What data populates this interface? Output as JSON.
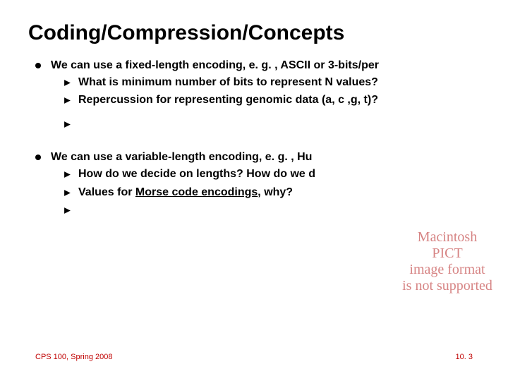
{
  "title": "Coding/Compression/Concepts",
  "bullets": {
    "b1": {
      "intro": "We can use a fixed-length encoding, e. g. , ASCII or 3-bits/per",
      "s1": "What is minimum number of bits to represent N values?",
      "s2": "Repercussion for representing genomic data (a, c ,g, t)?",
      "s3": ""
    },
    "b2": {
      "intro": "We can use a variable-length encoding, e. g. , Hu",
      "s1": "How do we decide on lengths? How do we d",
      "s2_pre": "Values for ",
      "s2_link": "Morse code encodings",
      "s2_post": ", why?",
      "s3": ""
    }
  },
  "overlay": {
    "l1": "Macintosh PICT",
    "l2": "image format",
    "l3": "is not supported"
  },
  "footer": {
    "left": "CPS 100, Spring 2008",
    "right": "10. 3"
  },
  "colors": {
    "title": "#000000",
    "accent": "#c00000"
  }
}
